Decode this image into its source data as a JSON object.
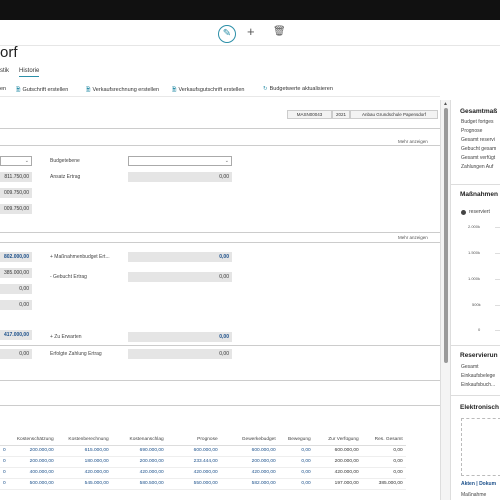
{
  "header": {
    "title": "orf",
    "edit_icon": "pencil-icon",
    "add_icon": "plus-icon",
    "delete_icon": "trash-icon"
  },
  "menu": {
    "item1": "stik",
    "item2": "Historie"
  },
  "toolbar": {
    "items": [
      "en",
      "Gutschrift erstellen",
      "Verkaufsrechnung erstellen",
      "Verkaufsgutschrift erstellen",
      "Budgetwerte aktualisieren"
    ]
  },
  "infobar": {
    "code": "MASN00043",
    "year": "2021",
    "desc": "Anbau Grundschule Papensdorf"
  },
  "section1": {
    "mehr": "Mehr anzeigen",
    "budgetebene_label": "Budgetebene",
    "ansatz_ertrag_label": "Ansatz Ertrag",
    "ansatz_ertrag_value": "0,00",
    "left_values": [
      "811.750,00",
      "009.750,00",
      "009.750,00"
    ]
  },
  "section2": {
    "mehr": "Mehr anzeigen",
    "left_values": [
      "802.000,00",
      "385.000,00",
      "0,00",
      "0,00",
      "417.000,00",
      "0,00"
    ],
    "massnahmen_label": "+ Maßnahmenbudget Ert...",
    "massnahmen_value": "0,00",
    "gebucht_label": "- Gebucht Ertrag",
    "gebucht_value": "0,00",
    "zuerwarten_label": "+ Zu Erwarten",
    "zuerwarten_value": "0,00",
    "erfolgte_label": "Erfolgte Zahlung Ertrag",
    "erfolgte_value": "0,00"
  },
  "grid": {
    "columns": [
      "",
      "Kostenschätzung",
      "Kostenberechnung",
      "Kostenanschlag",
      "Prognose",
      "Gewerkebudget",
      "Bewegung",
      "Zur Verfügung",
      "Res. Gesamt"
    ],
    "rows": [
      [
        "0",
        "200.000,00",
        "615.000,00",
        "690.000,00",
        "600.000,00",
        "600.000,00",
        "0,00",
        "600.000,00",
        "0,00"
      ],
      [
        "0",
        "200.000,00",
        "180.000,00",
        "200.000,00",
        "233.444,00",
        "200.000,00",
        "0,00",
        "200.000,00",
        "0,00"
      ],
      [
        "0",
        "400.000,00",
        "420.000,00",
        "420.000,00",
        "420.000,00",
        "420.000,00",
        "0,00",
        "420.000,00",
        "0,00"
      ],
      [
        "0",
        "500.000,00",
        "545.000,00",
        "580.500,00",
        "550.000,00",
        "582.000,00",
        "0,00",
        "197.000,00",
        "385.000,00"
      ]
    ]
  },
  "side": {
    "gesamt_title": "Gesamtmaß",
    "gesamt_items": [
      "Budget fortges",
      "Prognose",
      "Gesamt reservi",
      "Gebucht gesam",
      "Gesamt verfügt",
      "Zahlungen Auf"
    ],
    "massnahmen_title": "Maßnahmen",
    "legend": "reserviert",
    "axis": [
      "2.000k",
      "1.500k",
      "1.000k",
      "500k",
      "0"
    ],
    "reserv_title": "Reservierun",
    "reserv_items": [
      "Gesamt",
      "Einkaufsbelege",
      "Einkaufsbuch..."
    ],
    "elektro_title": "Elektronisch",
    "link": "Akten | Dokum",
    "bottom": "Maßnahme"
  }
}
